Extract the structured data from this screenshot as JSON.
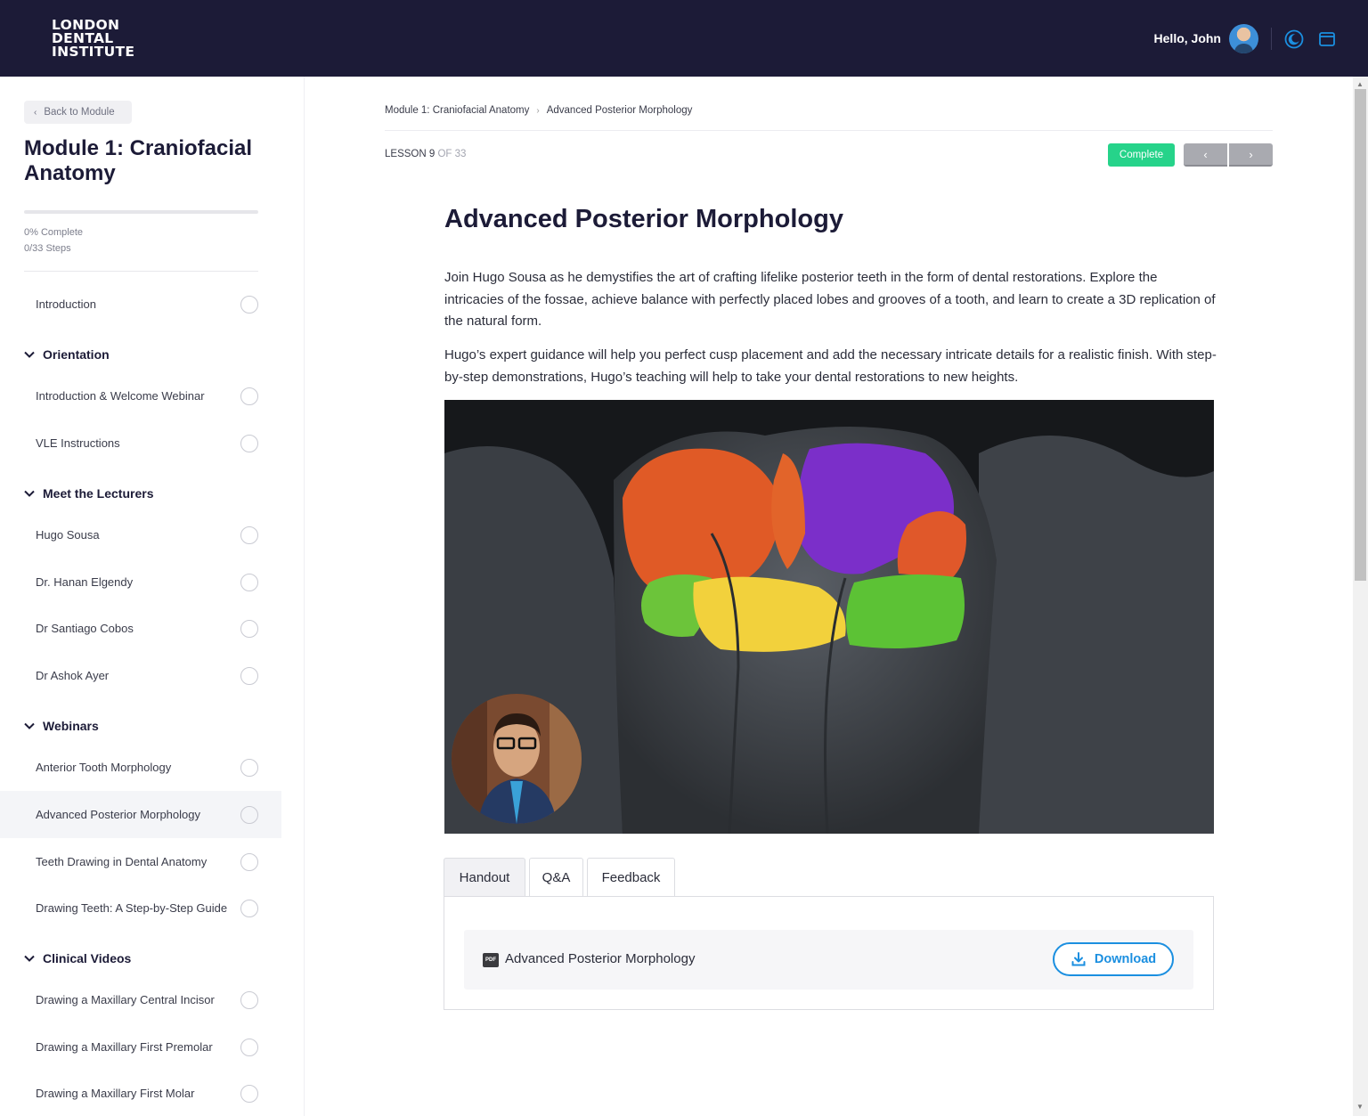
{
  "header": {
    "logo_lines": [
      "LONDON",
      "DENTAL",
      "INSTITUTE"
    ],
    "greeting_prefix": "Hello, ",
    "user_name": "John",
    "accent_color": "#1b8fe0",
    "bg_color": "#1c1b37"
  },
  "sidebar": {
    "back_label": "Back to Module",
    "module_title": "Module 1: Craniofacial Anatomy",
    "progress_percent_text": "0% Complete",
    "progress_steps_text": "0/33 Steps",
    "progress_fraction": 0,
    "intro_item": "Introduction",
    "sections": [
      {
        "title": "Orientation",
        "items": [
          "Introduction & Welcome Webinar",
          "VLE Instructions"
        ]
      },
      {
        "title": "Meet the Lecturers",
        "items": [
          "Hugo Sousa",
          "Dr. Hanan Elgendy",
          "Dr Santiago Cobos",
          "Dr Ashok Ayer"
        ]
      },
      {
        "title": "Webinars",
        "items": [
          "Anterior Tooth Morphology",
          "Advanced Posterior Morphology",
          "Teeth Drawing in Dental Anatomy",
          "Drawing Teeth: A Step-by-Step Guide"
        ]
      },
      {
        "title": "Clinical Videos",
        "items": [
          "Drawing a Maxillary Central Incisor",
          "Drawing a Maxillary First Premolar",
          "Drawing a Maxillary First Molar"
        ]
      }
    ]
  },
  "main": {
    "breadcrumb": [
      "Module 1: Craniofacial Anatomy",
      "Advanced Posterior Morphology"
    ],
    "lesson_label": "LESSON 9",
    "lesson_of": "OF 33",
    "complete_label": "Complete",
    "prev_label": "‹",
    "next_label": "›",
    "title": "Advanced Posterior Morphology",
    "paragraph1": "Join Hugo Sousa as he demystifies the art of crafting lifelike posterior teeth in the form of dental restorations. Explore the intricacies of the fossae, achieve balance with perfectly placed lobes and grooves of a tooth, and learn to create a 3D replication of the natural form.",
    "paragraph2": "Hugo’s expert guidance will help you perfect cusp placement and add the necessary intricate details for a realistic finish. With step-by-step demonstrations, Hugo’s teaching will help to take your dental restorations to new heights.",
    "tabs": [
      "Handout",
      "Q&A",
      "Feedback"
    ],
    "active_tab": "Handout",
    "file_badge": "PDF",
    "file_name": "Advanced Posterior Morphology",
    "download_label": "Download",
    "complete_color": "#26d38a"
  }
}
